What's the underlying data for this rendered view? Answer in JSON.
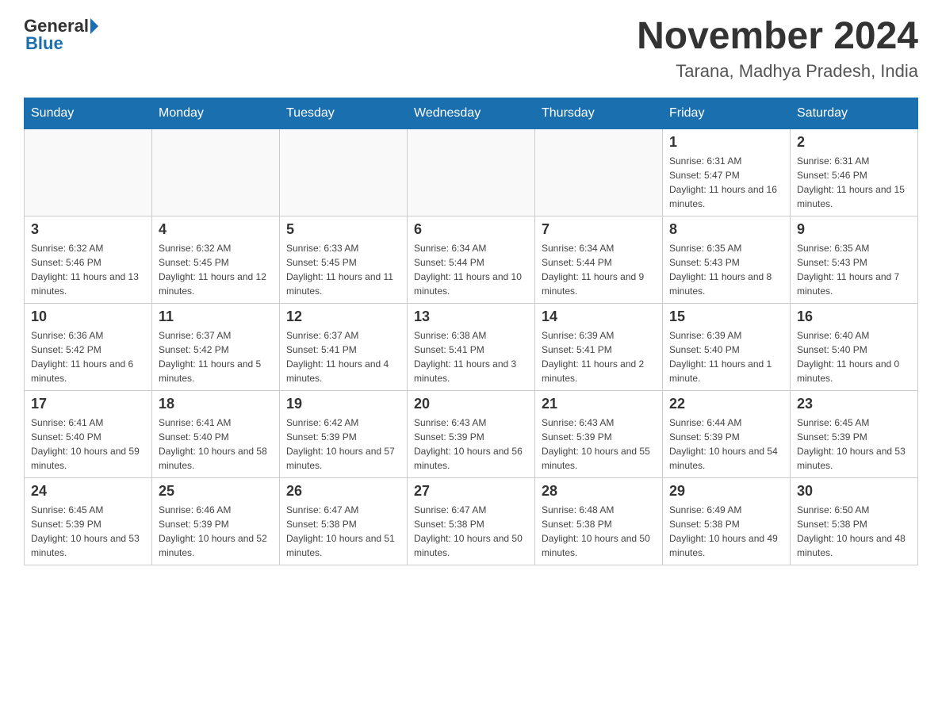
{
  "header": {
    "logo_general": "General",
    "logo_blue": "Blue",
    "title": "November 2024",
    "subtitle": "Tarana, Madhya Pradesh, India"
  },
  "weekdays": [
    "Sunday",
    "Monday",
    "Tuesday",
    "Wednesday",
    "Thursday",
    "Friday",
    "Saturday"
  ],
  "weeks": [
    [
      {
        "day": "",
        "info": ""
      },
      {
        "day": "",
        "info": ""
      },
      {
        "day": "",
        "info": ""
      },
      {
        "day": "",
        "info": ""
      },
      {
        "day": "",
        "info": ""
      },
      {
        "day": "1",
        "info": "Sunrise: 6:31 AM\nSunset: 5:47 PM\nDaylight: 11 hours and 16 minutes."
      },
      {
        "day": "2",
        "info": "Sunrise: 6:31 AM\nSunset: 5:46 PM\nDaylight: 11 hours and 15 minutes."
      }
    ],
    [
      {
        "day": "3",
        "info": "Sunrise: 6:32 AM\nSunset: 5:46 PM\nDaylight: 11 hours and 13 minutes."
      },
      {
        "day": "4",
        "info": "Sunrise: 6:32 AM\nSunset: 5:45 PM\nDaylight: 11 hours and 12 minutes."
      },
      {
        "day": "5",
        "info": "Sunrise: 6:33 AM\nSunset: 5:45 PM\nDaylight: 11 hours and 11 minutes."
      },
      {
        "day": "6",
        "info": "Sunrise: 6:34 AM\nSunset: 5:44 PM\nDaylight: 11 hours and 10 minutes."
      },
      {
        "day": "7",
        "info": "Sunrise: 6:34 AM\nSunset: 5:44 PM\nDaylight: 11 hours and 9 minutes."
      },
      {
        "day": "8",
        "info": "Sunrise: 6:35 AM\nSunset: 5:43 PM\nDaylight: 11 hours and 8 minutes."
      },
      {
        "day": "9",
        "info": "Sunrise: 6:35 AM\nSunset: 5:43 PM\nDaylight: 11 hours and 7 minutes."
      }
    ],
    [
      {
        "day": "10",
        "info": "Sunrise: 6:36 AM\nSunset: 5:42 PM\nDaylight: 11 hours and 6 minutes."
      },
      {
        "day": "11",
        "info": "Sunrise: 6:37 AM\nSunset: 5:42 PM\nDaylight: 11 hours and 5 minutes."
      },
      {
        "day": "12",
        "info": "Sunrise: 6:37 AM\nSunset: 5:41 PM\nDaylight: 11 hours and 4 minutes."
      },
      {
        "day": "13",
        "info": "Sunrise: 6:38 AM\nSunset: 5:41 PM\nDaylight: 11 hours and 3 minutes."
      },
      {
        "day": "14",
        "info": "Sunrise: 6:39 AM\nSunset: 5:41 PM\nDaylight: 11 hours and 2 minutes."
      },
      {
        "day": "15",
        "info": "Sunrise: 6:39 AM\nSunset: 5:40 PM\nDaylight: 11 hours and 1 minute."
      },
      {
        "day": "16",
        "info": "Sunrise: 6:40 AM\nSunset: 5:40 PM\nDaylight: 11 hours and 0 minutes."
      }
    ],
    [
      {
        "day": "17",
        "info": "Sunrise: 6:41 AM\nSunset: 5:40 PM\nDaylight: 10 hours and 59 minutes."
      },
      {
        "day": "18",
        "info": "Sunrise: 6:41 AM\nSunset: 5:40 PM\nDaylight: 10 hours and 58 minutes."
      },
      {
        "day": "19",
        "info": "Sunrise: 6:42 AM\nSunset: 5:39 PM\nDaylight: 10 hours and 57 minutes."
      },
      {
        "day": "20",
        "info": "Sunrise: 6:43 AM\nSunset: 5:39 PM\nDaylight: 10 hours and 56 minutes."
      },
      {
        "day": "21",
        "info": "Sunrise: 6:43 AM\nSunset: 5:39 PM\nDaylight: 10 hours and 55 minutes."
      },
      {
        "day": "22",
        "info": "Sunrise: 6:44 AM\nSunset: 5:39 PM\nDaylight: 10 hours and 54 minutes."
      },
      {
        "day": "23",
        "info": "Sunrise: 6:45 AM\nSunset: 5:39 PM\nDaylight: 10 hours and 53 minutes."
      }
    ],
    [
      {
        "day": "24",
        "info": "Sunrise: 6:45 AM\nSunset: 5:39 PM\nDaylight: 10 hours and 53 minutes."
      },
      {
        "day": "25",
        "info": "Sunrise: 6:46 AM\nSunset: 5:39 PM\nDaylight: 10 hours and 52 minutes."
      },
      {
        "day": "26",
        "info": "Sunrise: 6:47 AM\nSunset: 5:38 PM\nDaylight: 10 hours and 51 minutes."
      },
      {
        "day": "27",
        "info": "Sunrise: 6:47 AM\nSunset: 5:38 PM\nDaylight: 10 hours and 50 minutes."
      },
      {
        "day": "28",
        "info": "Sunrise: 6:48 AM\nSunset: 5:38 PM\nDaylight: 10 hours and 50 minutes."
      },
      {
        "day": "29",
        "info": "Sunrise: 6:49 AM\nSunset: 5:38 PM\nDaylight: 10 hours and 49 minutes."
      },
      {
        "day": "30",
        "info": "Sunrise: 6:50 AM\nSunset: 5:38 PM\nDaylight: 10 hours and 48 minutes."
      }
    ]
  ]
}
